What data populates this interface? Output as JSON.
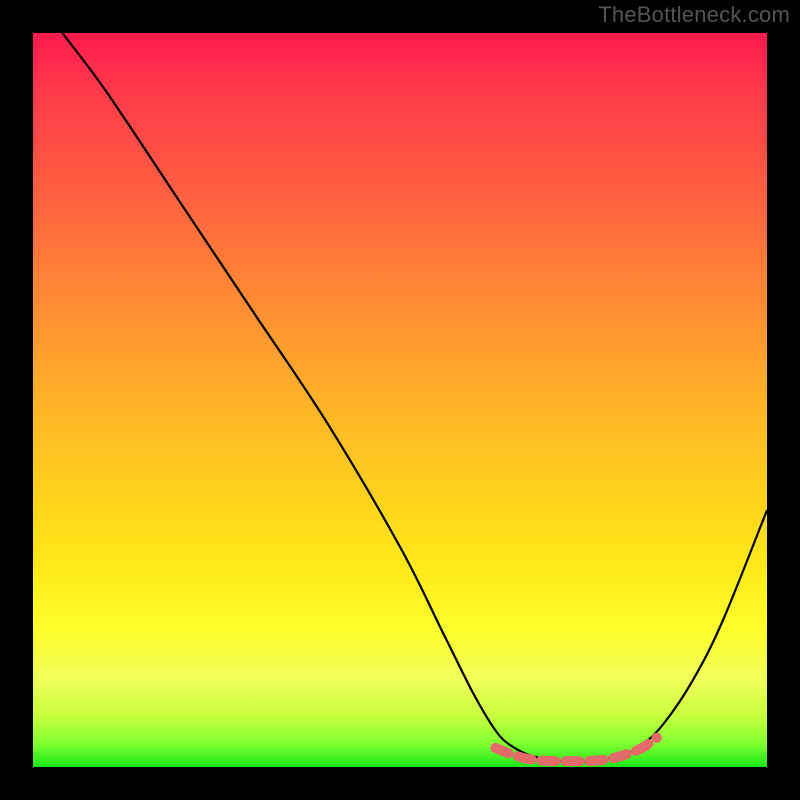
{
  "watermark": "TheBottleneck.com",
  "chart_data": {
    "type": "line",
    "title": "",
    "xlabel": "",
    "ylabel": "",
    "xlim": [
      0,
      100
    ],
    "ylim": [
      0,
      100
    ],
    "series": [
      {
        "name": "curve",
        "x": [
          4,
          10,
          20,
          30,
          40,
          50,
          56,
          60,
          63,
          65,
          68,
          72,
          76,
          80,
          83,
          86,
          90,
          94,
          100
        ],
        "y": [
          100,
          92,
          77,
          62,
          47,
          30,
          18,
          10,
          5,
          3,
          1.5,
          0.8,
          0.8,
          1.5,
          3,
          6,
          12,
          20,
          35
        ]
      },
      {
        "name": "marker-band",
        "x": [
          63,
          65,
          67,
          69,
          71,
          73,
          75,
          77,
          79,
          81,
          83,
          85
        ],
        "y": [
          2.6,
          1.8,
          1.2,
          0.9,
          0.8,
          0.8,
          0.8,
          0.9,
          1.2,
          1.8,
          2.6,
          4
        ]
      }
    ],
    "colors": {
      "curve_stroke": "#000000",
      "marker_stroke": "#e46a6a"
    }
  }
}
